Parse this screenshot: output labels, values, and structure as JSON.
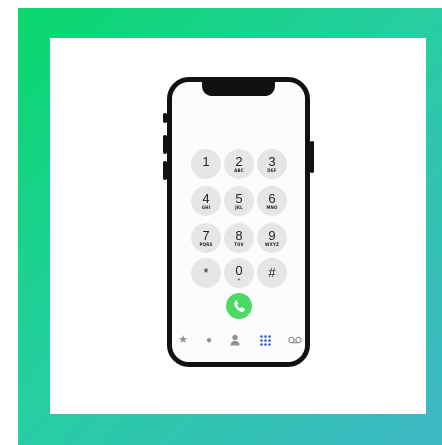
{
  "keypad": {
    "keys": [
      {
        "digit": "1",
        "letters": ""
      },
      {
        "digit": "2",
        "letters": "ABC"
      },
      {
        "digit": "3",
        "letters": "DEF"
      },
      {
        "digit": "4",
        "letters": "GHI"
      },
      {
        "digit": "5",
        "letters": "JKL"
      },
      {
        "digit": "6",
        "letters": "MNO"
      },
      {
        "digit": "7",
        "letters": "PQRS"
      },
      {
        "digit": "8",
        "letters": "TUV"
      },
      {
        "digit": "9",
        "letters": "WXYZ"
      },
      {
        "digit": "*",
        "letters": ""
      },
      {
        "digit": "0",
        "letters": "+"
      },
      {
        "digit": "#",
        "letters": ""
      }
    ]
  },
  "tabs": [
    {
      "icon": "star-icon",
      "glyph": "★"
    },
    {
      "icon": "clock-icon",
      "glyph": "●"
    },
    {
      "icon": "contacts-icon",
      "glyph": "👤"
    },
    {
      "icon": "keypad-icon",
      "glyph": "⠿"
    },
    {
      "icon": "voicemail-icon",
      "glyph": "oo"
    }
  ],
  "colors": {
    "frame_gradient_start": "#08d76c",
    "frame_gradient_end": "#3fb8c6",
    "call_button": "#4cd964",
    "active_tab": "#2f5fd8",
    "key_background": "#e5e7e6"
  }
}
